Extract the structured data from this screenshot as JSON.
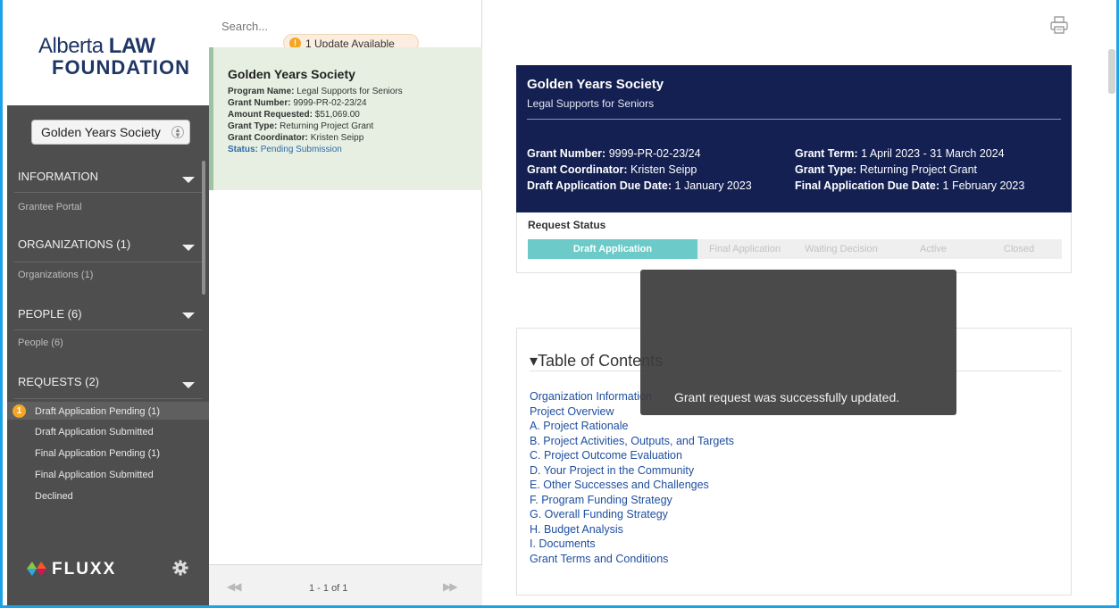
{
  "sidebar": {
    "logo": {
      "line1_prefix": "Alberta ",
      "line1_bold": "LAW",
      "line2": "FOUNDATION"
    },
    "org_select": {
      "value": "Golden Years Society"
    },
    "sections": [
      {
        "label": "INFORMATION",
        "items": [
          "Grantee Portal"
        ]
      },
      {
        "label": "ORGANIZATIONS (1)",
        "items": [
          "Organizations  (1)"
        ]
      },
      {
        "label": "PEOPLE (6)",
        "items": [
          "People  (6)"
        ]
      },
      {
        "label": "REQUESTS (2)",
        "items": []
      }
    ],
    "requests": {
      "badge": "1",
      "items": [
        "Draft Application Pending  (1)",
        "Draft Application Submitted",
        "Final Application Pending  (1)",
        "Final Application Submitted",
        "Declined"
      ]
    },
    "footer": {
      "brand": "FLUXX"
    }
  },
  "list": {
    "search_placeholder": "Search...",
    "update_badge": "!",
    "update_text": "1 Update Available",
    "card": {
      "title": "Golden Years Society",
      "program_label": "Program Name:",
      "program_value": "Legal Supports for Seniors",
      "grant_number_label": "Grant Number:",
      "grant_number_value": "9999-PR-02-23/24",
      "amount_label": "Amount Requested:",
      "amount_value": "$51,069.00",
      "type_label": "Grant Type:",
      "type_value": "Returning Project Grant",
      "coordinator_label": "Grant Coordinator:",
      "coordinator_value": "Kristen Seipp",
      "status_label": "Status:",
      "status_value": "Pending Submission"
    },
    "pager": {
      "prev": "◀◀",
      "text": "1 - 1 of 1",
      "next": "▶▶"
    }
  },
  "main": {
    "header": {
      "title": "Golden Years Society",
      "subtitle": "Legal Supports for Seniors",
      "grant_number_label": "Grant Number:",
      "grant_number_value": "9999-PR-02-23/24",
      "coordinator_label": "Grant Coordinator:",
      "coordinator_value": "Kristen Seipp",
      "draft_due_label": "Draft Application Due Date:",
      "draft_due_value": "1 January 2023",
      "term_label": "Grant Term:",
      "term_value": "1 April 2023 - 31 March 2024",
      "type_label": "Grant Type:",
      "type_value": "Returning Project Grant",
      "final_due_label": "Final Application Due Date:",
      "final_due_value": "1 February 2023"
    },
    "request_status": {
      "label": "Request Status",
      "steps": [
        "Draft Application",
        "Final  Application",
        "Waiting Decision",
        "Active",
        "Closed"
      ],
      "current": "Draft Application"
    },
    "toc": {
      "heading": "Table of Contents",
      "items": [
        "Organization Information",
        "Project Overview",
        "A. Project Rationale",
        "B. Project Activities, Outputs, and Targets",
        "C. Project Outcome Evaluation",
        "D. Your Project in the Community",
        "E. Other Successes and Challenges",
        "F. Program Funding Strategy",
        "G. Overall Funding Strategy",
        "H. Budget Analysis",
        "I. Documents",
        "Grant Terms and Conditions"
      ]
    },
    "toast": {
      "message": "Grant request was successfully updated."
    }
  },
  "colors": {
    "accent_blue": "#1aa3e6",
    "header_navy": "#142052",
    "status_teal": "#6ccac8",
    "badge_orange": "#f5a623",
    "sidebar_gray": "#4e4e4e",
    "card_green": "#e7efe2",
    "link_blue": "#1f4fa0"
  },
  "icons": [
    "print-icon",
    "gear-icon",
    "fluxx-logo-icon",
    "select-arrow-icon",
    "caret-down-icon"
  ]
}
